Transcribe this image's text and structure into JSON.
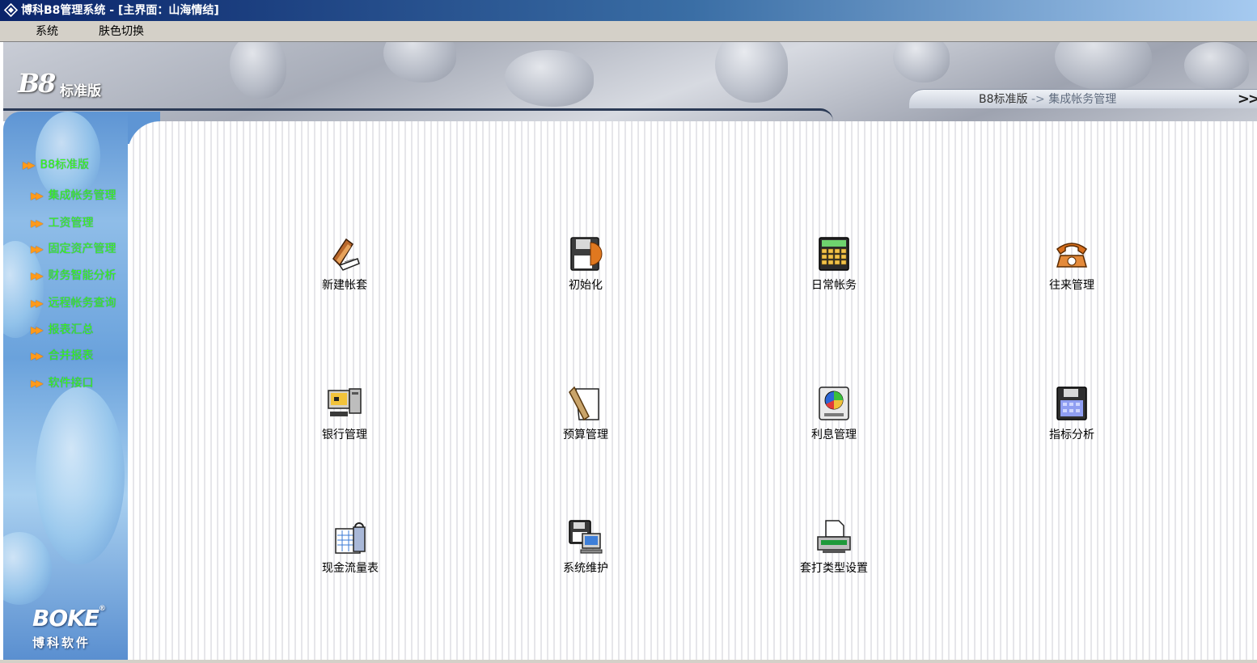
{
  "window": {
    "title": "博科B8管理系统 - [主界面：山海情结]"
  },
  "menu": [
    {
      "label": "系统"
    },
    {
      "label": "肤色切换"
    }
  ],
  "header": {
    "logo_main": "B8",
    "logo_sub": "标准版",
    "breadcrumb": {
      "root": "B8标准版",
      "separator": "->",
      "current": "集成帐务管理"
    },
    "forward_icon": ">>"
  },
  "sidebar": {
    "items": [
      {
        "label": "B8标准版"
      },
      {
        "label": "集成帐务管理"
      },
      {
        "label": "工资管理"
      },
      {
        "label": "固定资产管理"
      },
      {
        "label": "财务智能分析"
      },
      {
        "label": "远程帐务查询"
      },
      {
        "label": "报表汇总"
      },
      {
        "label": "合并报表"
      },
      {
        "label": "软件接口"
      }
    ],
    "brand": {
      "name": "BOKE",
      "reg": "®",
      "sub": "博科软件"
    }
  },
  "apps": [
    {
      "label": "新建帐套",
      "icon": "new-ledger-icon"
    },
    {
      "label": "初始化",
      "icon": "disk-init-icon"
    },
    {
      "label": "日常帐务",
      "icon": "calculator-icon"
    },
    {
      "label": "往来管理",
      "icon": "telephone-icon"
    },
    {
      "label": "银行管理",
      "icon": "computer-icon"
    },
    {
      "label": "预算管理",
      "icon": "clipboard-icon"
    },
    {
      "label": "利息管理",
      "icon": "pie-chart-icon"
    },
    {
      "label": "指标分析",
      "icon": "floppy-grid-icon"
    },
    {
      "label": "现金流量表",
      "icon": "cash-flow-icon"
    },
    {
      "label": "系统维护",
      "icon": "system-maintenance-icon"
    },
    {
      "label": "套打类型设置",
      "icon": "printer-icon"
    }
  ]
}
